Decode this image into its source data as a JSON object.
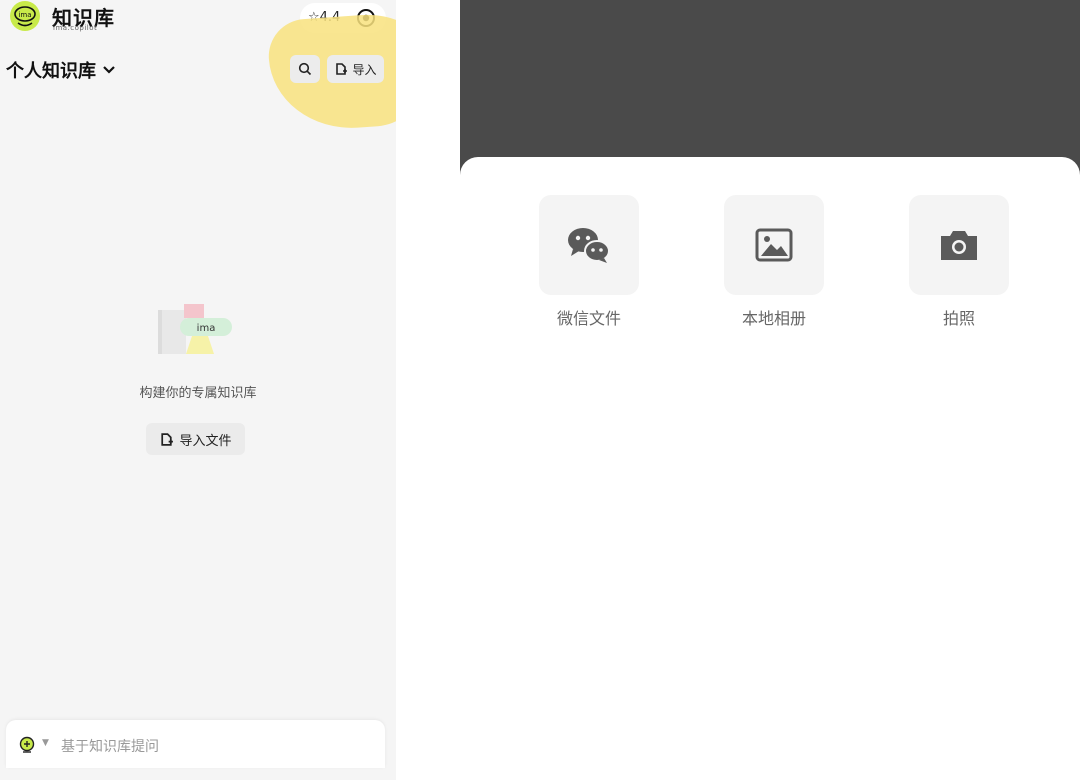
{
  "header": {
    "app_title": "知识库",
    "app_subtitle": "ima.copilot",
    "rating": "☆4.4"
  },
  "knowledge_base": {
    "title": "个人知识库",
    "import_label": "导入"
  },
  "empty_state": {
    "logo_text": "ima",
    "message": "构建你的专属知识库",
    "import_file_label": "导入文件"
  },
  "ask_bar": {
    "placeholder": "基于知识库提问"
  },
  "import_sheet": {
    "options": [
      {
        "label": "微信文件",
        "icon": "wechat-icon"
      },
      {
        "label": "本地相册",
        "icon": "image-icon"
      },
      {
        "label": "拍照",
        "icon": "camera-icon"
      }
    ]
  },
  "colors": {
    "logo_green": "#c8ea4a",
    "highlight_yellow": "#f8e27e",
    "overlay_dark": "#4a4a4a",
    "icon_gray": "#5a5a5a"
  }
}
